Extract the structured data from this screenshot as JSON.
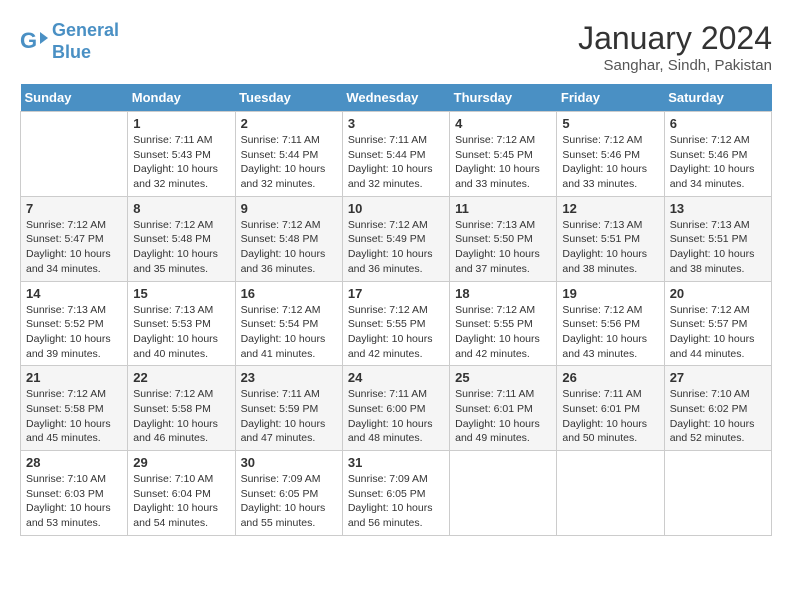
{
  "header": {
    "logo_line1": "General",
    "logo_line2": "Blue",
    "month": "January 2024",
    "location": "Sanghar, Sindh, Pakistan"
  },
  "weekdays": [
    "Sunday",
    "Monday",
    "Tuesday",
    "Wednesday",
    "Thursday",
    "Friday",
    "Saturday"
  ],
  "weeks": [
    [
      {
        "day": "",
        "info": ""
      },
      {
        "day": "1",
        "info": "Sunrise: 7:11 AM\nSunset: 5:43 PM\nDaylight: 10 hours\nand 32 minutes."
      },
      {
        "day": "2",
        "info": "Sunrise: 7:11 AM\nSunset: 5:44 PM\nDaylight: 10 hours\nand 32 minutes."
      },
      {
        "day": "3",
        "info": "Sunrise: 7:11 AM\nSunset: 5:44 PM\nDaylight: 10 hours\nand 32 minutes."
      },
      {
        "day": "4",
        "info": "Sunrise: 7:12 AM\nSunset: 5:45 PM\nDaylight: 10 hours\nand 33 minutes."
      },
      {
        "day": "5",
        "info": "Sunrise: 7:12 AM\nSunset: 5:46 PM\nDaylight: 10 hours\nand 33 minutes."
      },
      {
        "day": "6",
        "info": "Sunrise: 7:12 AM\nSunset: 5:46 PM\nDaylight: 10 hours\nand 34 minutes."
      }
    ],
    [
      {
        "day": "7",
        "info": "Sunrise: 7:12 AM\nSunset: 5:47 PM\nDaylight: 10 hours\nand 34 minutes."
      },
      {
        "day": "8",
        "info": "Sunrise: 7:12 AM\nSunset: 5:48 PM\nDaylight: 10 hours\nand 35 minutes."
      },
      {
        "day": "9",
        "info": "Sunrise: 7:12 AM\nSunset: 5:48 PM\nDaylight: 10 hours\nand 36 minutes."
      },
      {
        "day": "10",
        "info": "Sunrise: 7:12 AM\nSunset: 5:49 PM\nDaylight: 10 hours\nand 36 minutes."
      },
      {
        "day": "11",
        "info": "Sunrise: 7:13 AM\nSunset: 5:50 PM\nDaylight: 10 hours\nand 37 minutes."
      },
      {
        "day": "12",
        "info": "Sunrise: 7:13 AM\nSunset: 5:51 PM\nDaylight: 10 hours\nand 38 minutes."
      },
      {
        "day": "13",
        "info": "Sunrise: 7:13 AM\nSunset: 5:51 PM\nDaylight: 10 hours\nand 38 minutes."
      }
    ],
    [
      {
        "day": "14",
        "info": "Sunrise: 7:13 AM\nSunset: 5:52 PM\nDaylight: 10 hours\nand 39 minutes."
      },
      {
        "day": "15",
        "info": "Sunrise: 7:13 AM\nSunset: 5:53 PM\nDaylight: 10 hours\nand 40 minutes."
      },
      {
        "day": "16",
        "info": "Sunrise: 7:12 AM\nSunset: 5:54 PM\nDaylight: 10 hours\nand 41 minutes."
      },
      {
        "day": "17",
        "info": "Sunrise: 7:12 AM\nSunset: 5:55 PM\nDaylight: 10 hours\nand 42 minutes."
      },
      {
        "day": "18",
        "info": "Sunrise: 7:12 AM\nSunset: 5:55 PM\nDaylight: 10 hours\nand 42 minutes."
      },
      {
        "day": "19",
        "info": "Sunrise: 7:12 AM\nSunset: 5:56 PM\nDaylight: 10 hours\nand 43 minutes."
      },
      {
        "day": "20",
        "info": "Sunrise: 7:12 AM\nSunset: 5:57 PM\nDaylight: 10 hours\nand 44 minutes."
      }
    ],
    [
      {
        "day": "21",
        "info": "Sunrise: 7:12 AM\nSunset: 5:58 PM\nDaylight: 10 hours\nand 45 minutes."
      },
      {
        "day": "22",
        "info": "Sunrise: 7:12 AM\nSunset: 5:58 PM\nDaylight: 10 hours\nand 46 minutes."
      },
      {
        "day": "23",
        "info": "Sunrise: 7:11 AM\nSunset: 5:59 PM\nDaylight: 10 hours\nand 47 minutes."
      },
      {
        "day": "24",
        "info": "Sunrise: 7:11 AM\nSunset: 6:00 PM\nDaylight: 10 hours\nand 48 minutes."
      },
      {
        "day": "25",
        "info": "Sunrise: 7:11 AM\nSunset: 6:01 PM\nDaylight: 10 hours\nand 49 minutes."
      },
      {
        "day": "26",
        "info": "Sunrise: 7:11 AM\nSunset: 6:01 PM\nDaylight: 10 hours\nand 50 minutes."
      },
      {
        "day": "27",
        "info": "Sunrise: 7:10 AM\nSunset: 6:02 PM\nDaylight: 10 hours\nand 52 minutes."
      }
    ],
    [
      {
        "day": "28",
        "info": "Sunrise: 7:10 AM\nSunset: 6:03 PM\nDaylight: 10 hours\nand 53 minutes."
      },
      {
        "day": "29",
        "info": "Sunrise: 7:10 AM\nSunset: 6:04 PM\nDaylight: 10 hours\nand 54 minutes."
      },
      {
        "day": "30",
        "info": "Sunrise: 7:09 AM\nSunset: 6:05 PM\nDaylight: 10 hours\nand 55 minutes."
      },
      {
        "day": "31",
        "info": "Sunrise: 7:09 AM\nSunset: 6:05 PM\nDaylight: 10 hours\nand 56 minutes."
      },
      {
        "day": "",
        "info": ""
      },
      {
        "day": "",
        "info": ""
      },
      {
        "day": "",
        "info": ""
      }
    ]
  ]
}
